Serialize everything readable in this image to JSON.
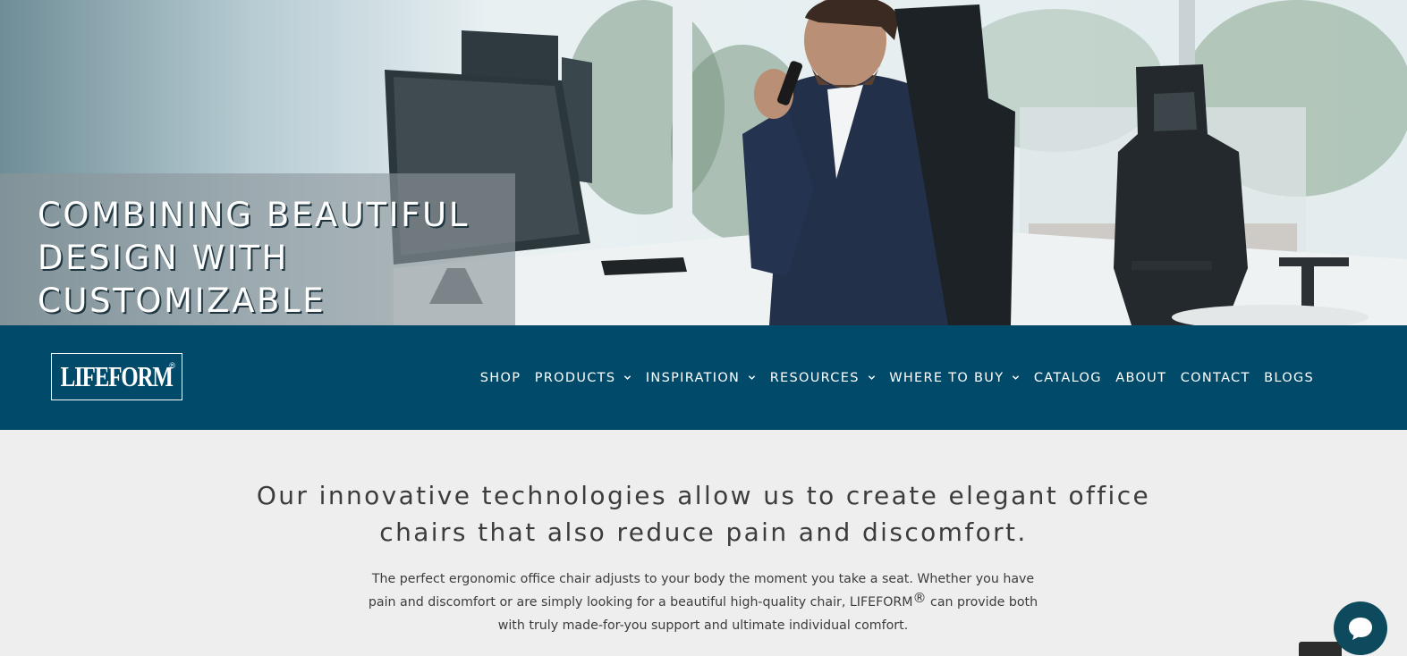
{
  "hero": {
    "title_lines": [
      "COMBINING BEAUTIFUL",
      "DESIGN WITH",
      "CUSTOMIZABLE"
    ]
  },
  "nav": {
    "logo_text": "LIFEFORM",
    "logo_mark": "®",
    "items": [
      {
        "label": "SHOP",
        "dropdown": false
      },
      {
        "label": "PRODUCTS",
        "dropdown": true
      },
      {
        "label": "INSPIRATION",
        "dropdown": true
      },
      {
        "label": "RESOURCES",
        "dropdown": true
      },
      {
        "label": "WHERE TO BUY",
        "dropdown": true
      },
      {
        "label": "CATALOG",
        "dropdown": false
      },
      {
        "label": "ABOUT",
        "dropdown": false
      },
      {
        "label": "CONTACT",
        "dropdown": false
      },
      {
        "label": "BLOGS",
        "dropdown": false
      }
    ]
  },
  "content": {
    "headline_lines": [
      "Our innovative technologies allow us to create elegant office",
      "chairs that also reduce pain and discomfort."
    ],
    "description_part1": "The perfect ergonomic office chair adjusts to your body the moment you take a seat. Whether you have pain and discomfort or are simply looking for a beautiful high-quality chair, LIFEFORM",
    "description_reg": "®",
    "description_part2": " can provide both with truly made-for-you support and ultimate individual comfort."
  },
  "colors": {
    "nav_bg": "#024a6a",
    "content_bg": "#eeeeee",
    "text": "#3c3c3c",
    "chat_button": "#0e4a5e"
  },
  "icons": [
    "chevron-down-icon",
    "chat-bubble-icon"
  ]
}
